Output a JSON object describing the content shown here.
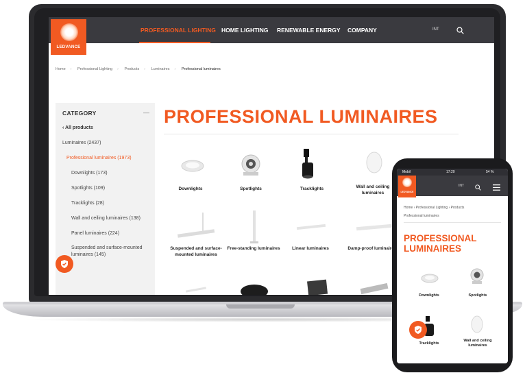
{
  "desktop": {
    "logo_text": "LEDVANCE",
    "nav": {
      "items": [
        "PROFESSIONAL LIGHTING",
        "HOME LIGHTING",
        "RENEWABLE ENERGY",
        "COMPANY"
      ],
      "country": "INT"
    },
    "breadcrumb": [
      "Home",
      "Professional Lighting",
      "Products",
      "Luminaires",
      "Professional luminaires"
    ],
    "sidebar": {
      "title": "CATEGORY",
      "collapse": "—",
      "back": "All products",
      "items": [
        "Luminaires (2437)",
        "Professional luminaires (1973)",
        "Downlights (173)",
        "Spotlights (109)",
        "Tracklights (28)",
        "Wall and ceiling luminaires (138)",
        "Panel luminaires (224)",
        "Suspended and surface-mounted",
        "luminaires (145)"
      ]
    },
    "heading": "PROFESSIONAL LUMINAIRES",
    "products": [
      {
        "label": "Downlights"
      },
      {
        "label": "Spotlights"
      },
      {
        "label": "Tracklights"
      },
      {
        "label": "Wall and ceiling luminaires"
      },
      {
        "label": "Suspended and surface-mounted luminaires"
      },
      {
        "label": "Free-standing luminaires"
      },
      {
        "label": "Linear luminaires"
      },
      {
        "label": "Damp-proof luminaires"
      }
    ]
  },
  "mobile": {
    "status": {
      "carrier": "Mobil",
      "time": "17:20",
      "battery": "54 %"
    },
    "logo_text": "LEDVANCE",
    "country": "INT",
    "breadcrumb": [
      "Home",
      "Professional Lighting",
      "Products",
      "Professional luminaires"
    ],
    "heading_line1": "PROFESSIONAL",
    "heading_line2": "LUMINAIRES",
    "products": [
      {
        "label": "Downlights"
      },
      {
        "label": "Spotlights"
      },
      {
        "label": "Tracklights"
      },
      {
        "label": "Wall and ceiling luminaires"
      }
    ]
  },
  "colors": {
    "brand": "#f15a22",
    "nav": "#3a3a3f"
  }
}
